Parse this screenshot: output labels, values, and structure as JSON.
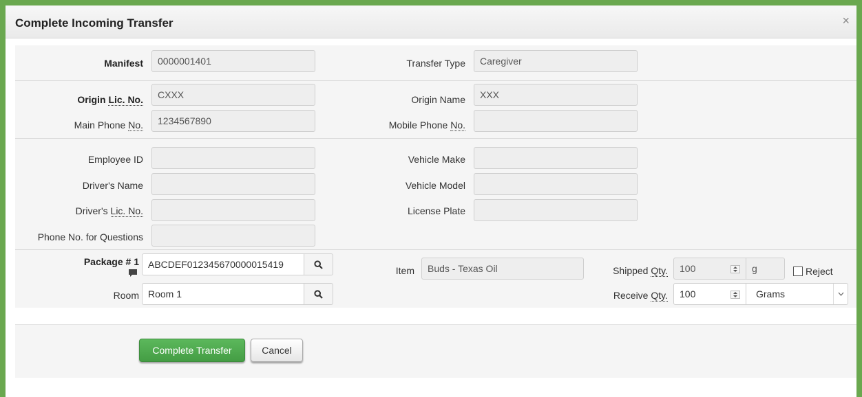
{
  "dialog": {
    "title": "Complete Incoming Transfer",
    "close_glyph": "×"
  },
  "header": {
    "manifest_label": "Manifest",
    "manifest_value": "0000001401",
    "transfer_type_label": "Transfer Type",
    "transfer_type_value": "Caregiver"
  },
  "origin": {
    "lic_label_prefix": "Origin ",
    "lic_label_abbr": "Lic. No.",
    "lic_value": "CXXX",
    "name_label": "Origin Name",
    "name_value": "XXX",
    "main_phone_prefix": "Main Phone ",
    "main_phone_abbr": "No.",
    "main_phone_value": "1234567890",
    "mobile_phone_prefix": "Mobile Phone ",
    "mobile_phone_abbr": "No.",
    "mobile_phone_value": ""
  },
  "driver": {
    "employee_id_label": "Employee ID",
    "employee_id_value": "",
    "drivers_name_label": "Driver's Name",
    "drivers_name_value": "",
    "drivers_lic_prefix": "Driver's ",
    "drivers_lic_abbr": "Lic. No.",
    "drivers_lic_value": "",
    "phone_questions_label": "Phone No. for Questions",
    "phone_questions_value": "",
    "vehicle_make_label": "Vehicle Make",
    "vehicle_make_value": "",
    "vehicle_model_label": "Vehicle Model",
    "vehicle_model_value": "",
    "license_plate_label": "License Plate",
    "license_plate_value": ""
  },
  "package": {
    "label": "Package # 1",
    "tag_value": "ABCDEF012345670000015419",
    "room_label": "Room",
    "room_value": "Room 1",
    "item_label": "Item",
    "item_value": "Buds - Texas Oil",
    "shipped_prefix": "Shipped ",
    "shipped_abbr": "Qty.",
    "shipped_value": "100",
    "shipped_unit": "g",
    "reject_label": "Reject",
    "receive_prefix": "Receive ",
    "receive_abbr": "Qty.",
    "receive_value": "100",
    "receive_unit": "Grams"
  },
  "actions": {
    "complete_label": "Complete Transfer",
    "cancel_label": "Cancel"
  },
  "colors": {
    "frame": "#6aa84f",
    "primary_button": "#5cb85c"
  }
}
